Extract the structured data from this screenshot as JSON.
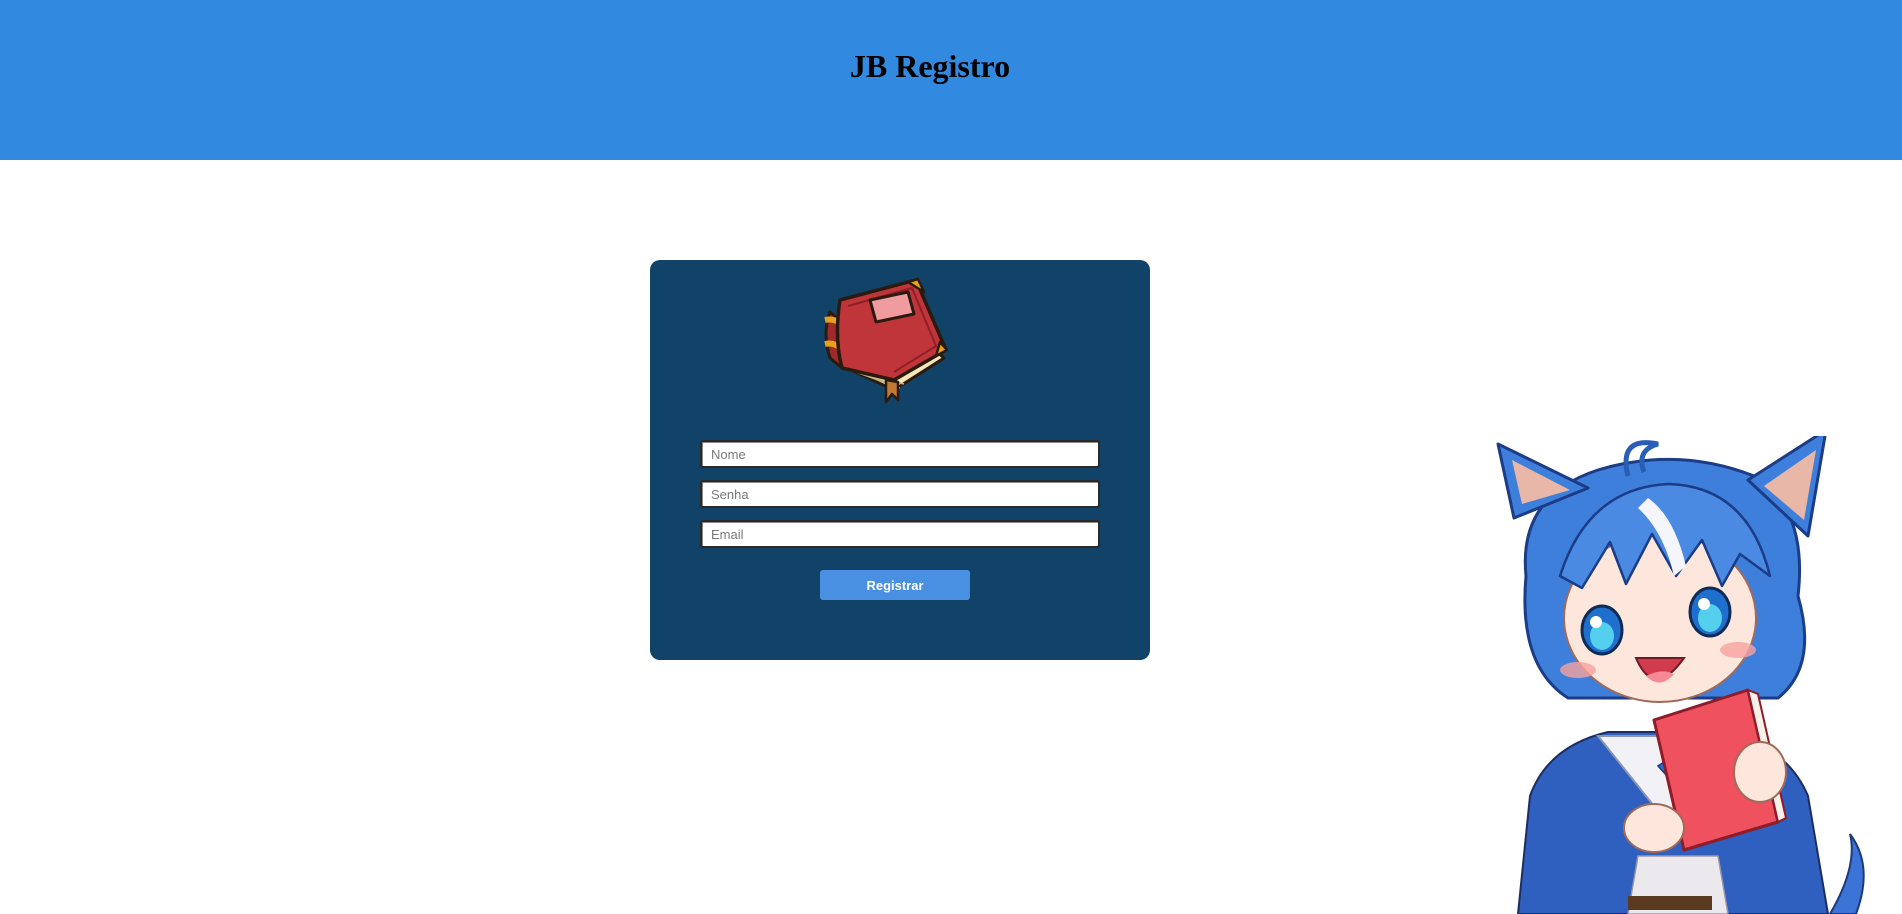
{
  "header": {
    "title": "JB Registro",
    "bg_color": "#3189e0"
  },
  "form": {
    "bg_color": "#114368",
    "logo_icon": "red-book-icon",
    "fields": [
      {
        "placeholder": "Nome",
        "value": ""
      },
      {
        "placeholder": "Senha",
        "value": ""
      },
      {
        "placeholder": "Email",
        "value": ""
      }
    ],
    "submit_label": "Registrar",
    "button_color": "#4a90e2"
  },
  "decoration": {
    "mascot": "anime-cat-girl-holding-book-illustration"
  }
}
